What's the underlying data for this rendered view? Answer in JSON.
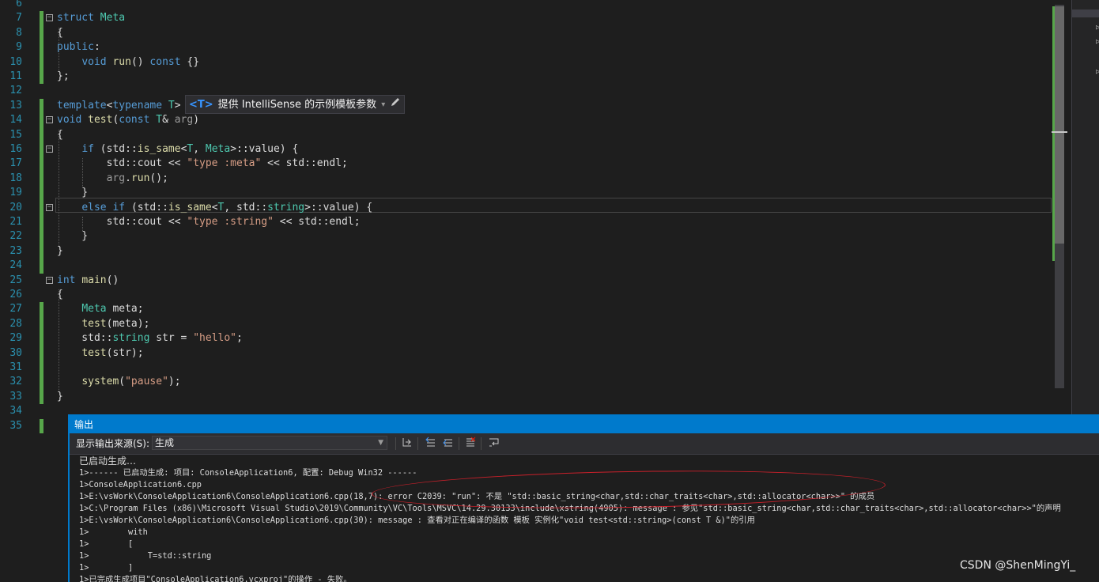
{
  "editor": {
    "lines": [
      {
        "n": "6",
        "segs": []
      },
      {
        "n": "7",
        "fold": "−",
        "segs": [
          [
            "kw",
            "struct "
          ],
          [
            "ty",
            "Meta"
          ]
        ]
      },
      {
        "n": "8",
        "segs": [
          [
            "tx",
            "{"
          ]
        ]
      },
      {
        "n": "9",
        "segs": [
          [
            "kw",
            "public"
          ],
          [
            "tx",
            ":"
          ]
        ]
      },
      {
        "n": "10",
        "segs": [
          [
            "tx",
            "    "
          ],
          [
            "kw",
            "void "
          ],
          [
            "fn",
            "run"
          ],
          [
            "tx",
            "() "
          ],
          [
            "kw",
            "const "
          ],
          [
            "tx",
            "{}"
          ]
        ]
      },
      {
        "n": "11",
        "segs": [
          [
            "tx",
            "};"
          ]
        ]
      },
      {
        "n": "12",
        "segs": []
      },
      {
        "n": "13",
        "segs": [
          [
            "kw",
            "template"
          ],
          [
            "tx",
            "<"
          ],
          [
            "kw",
            "typename "
          ],
          [
            "ty",
            "T"
          ],
          [
            "tx",
            ">"
          ]
        ]
      },
      {
        "n": "14",
        "fold": "−",
        "segs": [
          [
            "kw",
            "void "
          ],
          [
            "fn",
            "test"
          ],
          [
            "tx",
            "("
          ],
          [
            "kw",
            "const "
          ],
          [
            "ty",
            "T"
          ],
          [
            "tx",
            "& "
          ],
          [
            "pm",
            "arg"
          ],
          [
            "tx",
            ")"
          ]
        ]
      },
      {
        "n": "15",
        "segs": [
          [
            "tx",
            "{"
          ]
        ]
      },
      {
        "n": "16",
        "fold": "−",
        "segs": [
          [
            "tx",
            "    "
          ],
          [
            "kw",
            "if "
          ],
          [
            "tx",
            "(std::"
          ],
          [
            "fn",
            "is_same"
          ],
          [
            "tx",
            "<"
          ],
          [
            "ty",
            "T"
          ],
          [
            "tx",
            ", "
          ],
          [
            "ty",
            "Meta"
          ],
          [
            "tx",
            ">::value) {"
          ]
        ]
      },
      {
        "n": "17",
        "segs": [
          [
            "tx",
            "        std::cout << "
          ],
          [
            "st",
            "\"type :meta\""
          ],
          [
            "tx",
            " << std::endl;"
          ]
        ]
      },
      {
        "n": "18",
        "segs": [
          [
            "tx",
            "        "
          ],
          [
            "pm",
            "arg"
          ],
          [
            "tx",
            "."
          ],
          [
            "fn",
            "run"
          ],
          [
            "tx",
            "();"
          ]
        ]
      },
      {
        "n": "19",
        "segs": [
          [
            "tx",
            "    }"
          ]
        ]
      },
      {
        "n": "20",
        "fold": "−",
        "segs": [
          [
            "tx",
            "    "
          ],
          [
            "kw",
            "else if "
          ],
          [
            "tx",
            "(std::"
          ],
          [
            "fn",
            "is_same"
          ],
          [
            "tx",
            "<"
          ],
          [
            "ty",
            "T"
          ],
          [
            "tx",
            ", std::"
          ],
          [
            "ty",
            "string"
          ],
          [
            "tx",
            ">::value) {"
          ]
        ]
      },
      {
        "n": "21",
        "segs": [
          [
            "tx",
            "        std::cout << "
          ],
          [
            "st",
            "\"type :string\""
          ],
          [
            "tx",
            " << std::endl;"
          ]
        ]
      },
      {
        "n": "22",
        "segs": [
          [
            "tx",
            "    }"
          ]
        ]
      },
      {
        "n": "23",
        "segs": [
          [
            "tx",
            "}"
          ]
        ]
      },
      {
        "n": "24",
        "segs": []
      },
      {
        "n": "25",
        "fold": "−",
        "segs": [
          [
            "kw",
            "int "
          ],
          [
            "fn",
            "main"
          ],
          [
            "tx",
            "()"
          ]
        ]
      },
      {
        "n": "26",
        "segs": [
          [
            "tx",
            "{"
          ]
        ]
      },
      {
        "n": "27",
        "segs": [
          [
            "tx",
            "    "
          ],
          [
            "ty",
            "Meta "
          ],
          [
            "tx",
            "meta;"
          ]
        ]
      },
      {
        "n": "28",
        "segs": [
          [
            "tx",
            "    "
          ],
          [
            "fn",
            "test"
          ],
          [
            "tx",
            "(meta);"
          ]
        ]
      },
      {
        "n": "29",
        "segs": [
          [
            "tx",
            "    std::"
          ],
          [
            "ty",
            "string "
          ],
          [
            "tx",
            "str = "
          ],
          [
            "st",
            "\"hello\""
          ],
          [
            "tx",
            ";"
          ]
        ]
      },
      {
        "n": "30",
        "segs": [
          [
            "tx",
            "    "
          ],
          [
            "fn",
            "test"
          ],
          [
            "tx",
            "(str);"
          ]
        ]
      },
      {
        "n": "31",
        "segs": []
      },
      {
        "n": "32",
        "segs": [
          [
            "tx",
            "    "
          ],
          [
            "fn",
            "system"
          ],
          [
            "tx",
            "("
          ],
          [
            "st",
            "\"pause\""
          ],
          [
            "tx",
            ");"
          ]
        ]
      },
      {
        "n": "33",
        "segs": [
          [
            "tx",
            "}"
          ]
        ]
      },
      {
        "n": "34",
        "segs": []
      },
      {
        "n": "35",
        "segs": []
      }
    ],
    "intellisense": {
      "tag": "<T>",
      "text": "提供 IntelliSense 的示例模板参数",
      "dropdown": "▾",
      "edit_icon": "pencil-icon"
    }
  },
  "output_panel": {
    "title": "输出",
    "source_label": "显示输出来源(S):",
    "source_value": "生成",
    "toolbar_icons": [
      "goto-location-icon",
      "prev-message-icon",
      "next-message-icon",
      "clear-all-icon",
      "word-wrap-icon"
    ],
    "lines": [
      "已启动生成…",
      "1>------ 已启动生成: 项目: ConsoleApplication6, 配置: Debug Win32 ------",
      "1>ConsoleApplication6.cpp",
      "1>E:\\vsWork\\ConsoleApplication6\\ConsoleApplication6.cpp(18,7): error C2039: \"run\": 不是 \"std::basic_string<char,std::char_traits<char>,std::allocator<char>>\" 的成员",
      "1>C:\\Program Files (x86)\\Microsoft Visual Studio\\2019\\Community\\VC\\Tools\\MSVC\\14.29.30133\\include\\xstring(4905): message : 参见\"std::basic_string<char,std::char_traits<char>,std::allocator<char>>\"的声明",
      "1>E:\\vsWork\\ConsoleApplication6\\ConsoleApplication6.cpp(30): message : 查看对正在编译的函数 模板 实例化\"void test<std::string>(const T &)\"的引用",
      "1>        with",
      "1>        [",
      "1>            T=std::string",
      "1>        ]",
      "1>已完成生成项目\"ConsoleApplication6.vcxproj\"的操作 - 失败。"
    ]
  },
  "watermark": "CSDN @ShenMingYi_",
  "colors": {
    "accent": "#007acc",
    "keyword": "#569cd6",
    "type": "#4ec9b0",
    "function": "#dcdcaa",
    "string": "#d69d85",
    "change_bar": "#57a64a",
    "annotation": "#c8202a"
  }
}
